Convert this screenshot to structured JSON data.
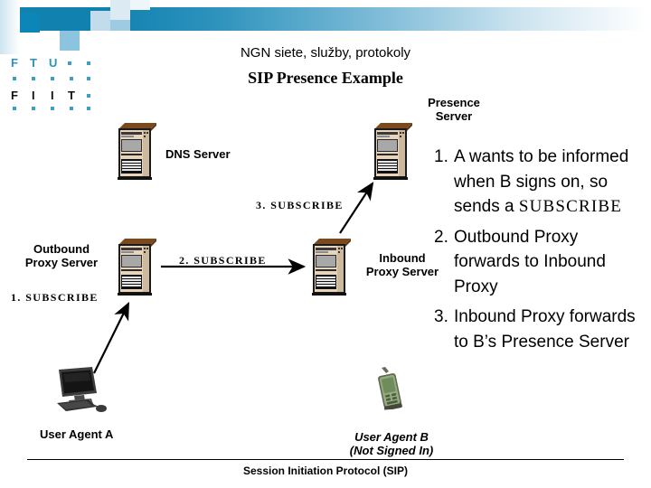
{
  "slide": {
    "title_line1": "NGN siete, služby, protokoly",
    "title_line2": "SIP Presence Example",
    "footer": "Session Initiation Protocol (SIP)"
  },
  "logo": {
    "row1": "S T U",
    "letters": [
      "S",
      "T",
      "U",
      "F",
      "I",
      "I",
      "T"
    ],
    "line1_chars": [
      "S",
      "T",
      "U"
    ],
    "line2_chars": [
      "F",
      "I",
      "I",
      "T"
    ]
  },
  "nodes": [
    {
      "id": "dns-server",
      "label": "DNS Server",
      "icon": "server-rack-icon"
    },
    {
      "id": "presence-server",
      "label": "Presence\nServer",
      "label_l1": "Presence",
      "label_l2": "Server",
      "icon": "server-rack-icon"
    },
    {
      "id": "outbound-proxy",
      "label": "Outbound\nProxy Server",
      "label_l1": "Outbound",
      "label_l2": "Proxy Server",
      "icon": "server-rack-icon"
    },
    {
      "id": "inbound-proxy",
      "label": "Inbound\nProxy Server",
      "label_l1": "Inbound",
      "label_l2": "Proxy Server",
      "icon": "server-rack-icon"
    },
    {
      "id": "user-agent-a",
      "label": "User Agent A",
      "icon": "desktop-computer-icon"
    },
    {
      "id": "user-agent-b",
      "label_l1": "User Agent B",
      "label_l2": "(Not Signed In)",
      "icon": "mobile-phone-icon"
    }
  ],
  "messages": [
    {
      "id": "msg-1",
      "text": "1.  SUBSCRIBE"
    },
    {
      "id": "msg-2",
      "text": "2.  SUBSCRIBE"
    },
    {
      "id": "msg-3",
      "text": "3.  SUBSCRIBE"
    }
  ],
  "bullets": [
    {
      "num": "1.",
      "text_before": "A wants to be informed when B signs on, so sends a ",
      "mono": "SUBSCRIBE",
      "text_after": ""
    },
    {
      "num": "2.",
      "text_before": "Outbound Proxy forwards to Inbound Proxy",
      "mono": "",
      "text_after": ""
    },
    {
      "num": "3.",
      "text_before": "Inbound Proxy forwards to B’s Presence Server",
      "mono": "",
      "text_after": ""
    }
  ],
  "colors": {
    "banner_blue": "#1181b0",
    "logo_blue": "#3f9ec4",
    "server_top": "#7a4a1e",
    "server_body": "#e8d5bd",
    "phone_green": "#8aa878",
    "text": "#000000"
  }
}
